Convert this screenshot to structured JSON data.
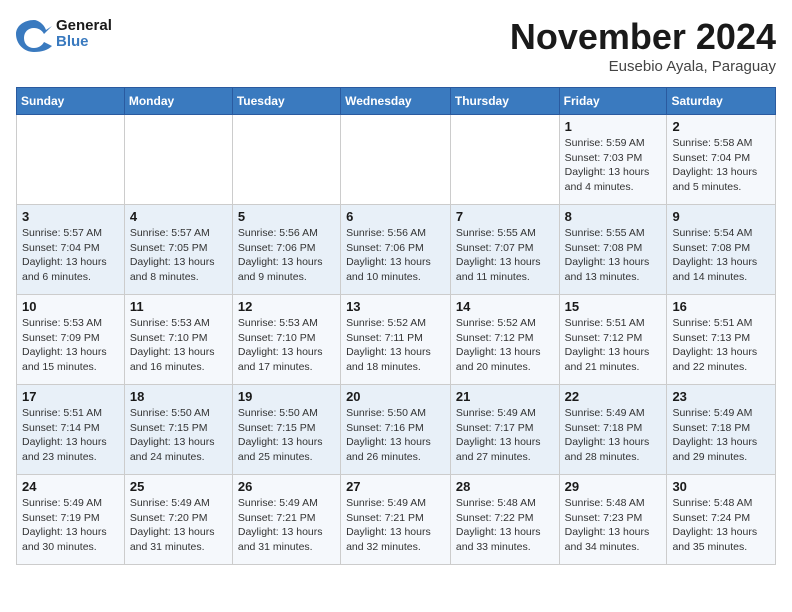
{
  "header": {
    "logo_line1": "General",
    "logo_line2": "Blue",
    "month": "November 2024",
    "location": "Eusebio Ayala, Paraguay"
  },
  "weekdays": [
    "Sunday",
    "Monday",
    "Tuesday",
    "Wednesday",
    "Thursday",
    "Friday",
    "Saturday"
  ],
  "weeks": [
    [
      {
        "day": "",
        "info": ""
      },
      {
        "day": "",
        "info": ""
      },
      {
        "day": "",
        "info": ""
      },
      {
        "day": "",
        "info": ""
      },
      {
        "day": "",
        "info": ""
      },
      {
        "day": "1",
        "info": "Sunrise: 5:59 AM\nSunset: 7:03 PM\nDaylight: 13 hours\nand 4 minutes."
      },
      {
        "day": "2",
        "info": "Sunrise: 5:58 AM\nSunset: 7:04 PM\nDaylight: 13 hours\nand 5 minutes."
      }
    ],
    [
      {
        "day": "3",
        "info": "Sunrise: 5:57 AM\nSunset: 7:04 PM\nDaylight: 13 hours\nand 6 minutes."
      },
      {
        "day": "4",
        "info": "Sunrise: 5:57 AM\nSunset: 7:05 PM\nDaylight: 13 hours\nand 8 minutes."
      },
      {
        "day": "5",
        "info": "Sunrise: 5:56 AM\nSunset: 7:06 PM\nDaylight: 13 hours\nand 9 minutes."
      },
      {
        "day": "6",
        "info": "Sunrise: 5:56 AM\nSunset: 7:06 PM\nDaylight: 13 hours\nand 10 minutes."
      },
      {
        "day": "7",
        "info": "Sunrise: 5:55 AM\nSunset: 7:07 PM\nDaylight: 13 hours\nand 11 minutes."
      },
      {
        "day": "8",
        "info": "Sunrise: 5:55 AM\nSunset: 7:08 PM\nDaylight: 13 hours\nand 13 minutes."
      },
      {
        "day": "9",
        "info": "Sunrise: 5:54 AM\nSunset: 7:08 PM\nDaylight: 13 hours\nand 14 minutes."
      }
    ],
    [
      {
        "day": "10",
        "info": "Sunrise: 5:53 AM\nSunset: 7:09 PM\nDaylight: 13 hours\nand 15 minutes."
      },
      {
        "day": "11",
        "info": "Sunrise: 5:53 AM\nSunset: 7:10 PM\nDaylight: 13 hours\nand 16 minutes."
      },
      {
        "day": "12",
        "info": "Sunrise: 5:53 AM\nSunset: 7:10 PM\nDaylight: 13 hours\nand 17 minutes."
      },
      {
        "day": "13",
        "info": "Sunrise: 5:52 AM\nSunset: 7:11 PM\nDaylight: 13 hours\nand 18 minutes."
      },
      {
        "day": "14",
        "info": "Sunrise: 5:52 AM\nSunset: 7:12 PM\nDaylight: 13 hours\nand 20 minutes."
      },
      {
        "day": "15",
        "info": "Sunrise: 5:51 AM\nSunset: 7:12 PM\nDaylight: 13 hours\nand 21 minutes."
      },
      {
        "day": "16",
        "info": "Sunrise: 5:51 AM\nSunset: 7:13 PM\nDaylight: 13 hours\nand 22 minutes."
      }
    ],
    [
      {
        "day": "17",
        "info": "Sunrise: 5:51 AM\nSunset: 7:14 PM\nDaylight: 13 hours\nand 23 minutes."
      },
      {
        "day": "18",
        "info": "Sunrise: 5:50 AM\nSunset: 7:15 PM\nDaylight: 13 hours\nand 24 minutes."
      },
      {
        "day": "19",
        "info": "Sunrise: 5:50 AM\nSunset: 7:15 PM\nDaylight: 13 hours\nand 25 minutes."
      },
      {
        "day": "20",
        "info": "Sunrise: 5:50 AM\nSunset: 7:16 PM\nDaylight: 13 hours\nand 26 minutes."
      },
      {
        "day": "21",
        "info": "Sunrise: 5:49 AM\nSunset: 7:17 PM\nDaylight: 13 hours\nand 27 minutes."
      },
      {
        "day": "22",
        "info": "Sunrise: 5:49 AM\nSunset: 7:18 PM\nDaylight: 13 hours\nand 28 minutes."
      },
      {
        "day": "23",
        "info": "Sunrise: 5:49 AM\nSunset: 7:18 PM\nDaylight: 13 hours\nand 29 minutes."
      }
    ],
    [
      {
        "day": "24",
        "info": "Sunrise: 5:49 AM\nSunset: 7:19 PM\nDaylight: 13 hours\nand 30 minutes."
      },
      {
        "day": "25",
        "info": "Sunrise: 5:49 AM\nSunset: 7:20 PM\nDaylight: 13 hours\nand 31 minutes."
      },
      {
        "day": "26",
        "info": "Sunrise: 5:49 AM\nSunset: 7:21 PM\nDaylight: 13 hours\nand 31 minutes."
      },
      {
        "day": "27",
        "info": "Sunrise: 5:49 AM\nSunset: 7:21 PM\nDaylight: 13 hours\nand 32 minutes."
      },
      {
        "day": "28",
        "info": "Sunrise: 5:48 AM\nSunset: 7:22 PM\nDaylight: 13 hours\nand 33 minutes."
      },
      {
        "day": "29",
        "info": "Sunrise: 5:48 AM\nSunset: 7:23 PM\nDaylight: 13 hours\nand 34 minutes."
      },
      {
        "day": "30",
        "info": "Sunrise: 5:48 AM\nSunset: 7:24 PM\nDaylight: 13 hours\nand 35 minutes."
      }
    ]
  ]
}
